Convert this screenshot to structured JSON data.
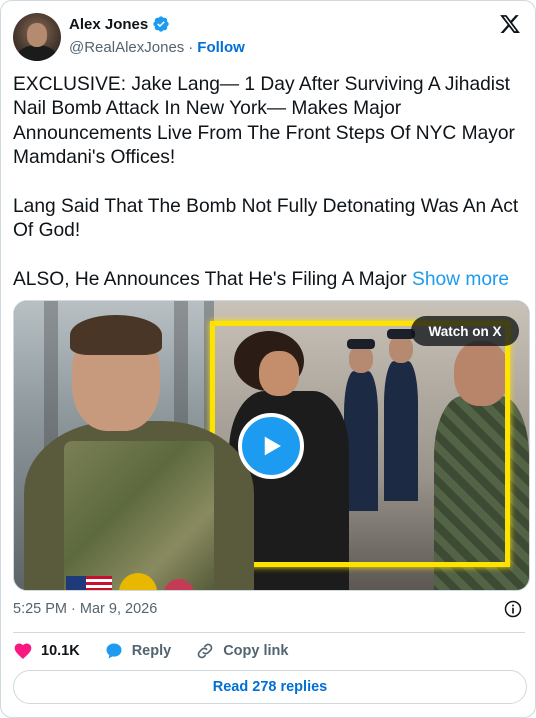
{
  "author": {
    "name": "Alex Jones",
    "handle": "@RealAlexJones",
    "separator": "·",
    "follow_label": "Follow",
    "verified": true
  },
  "tweet": {
    "paragraphs": [
      "EXCLUSIVE: Jake Lang— 1 Day After Surviving A Jihadist Nail Bomb Attack In New York— Makes Major Announcements Live From The Front Steps Of NYC Mayor Mamdani's Offices!",
      "Lang Said That The Bomb Not Fully Detonating Was An Act Of God!",
      "ALSO, He Announces That He's Filing A Major"
    ],
    "show_more_label": "Show more"
  },
  "media": {
    "watch_label": "Watch on X",
    "play_icon": "play-icon"
  },
  "meta": {
    "timestamp": "5:25 PM · Mar 9, 2026"
  },
  "actions": {
    "likes": "10.1K",
    "reply_label": "Reply",
    "copy_link_label": "Copy link"
  },
  "footer": {
    "read_replies_label": "Read 278 replies"
  },
  "colors": {
    "accent": "#1d9bf0",
    "link": "#006fd6",
    "heart": "#f91880",
    "muted": "#536471",
    "highlight_frame": "#ffe300"
  }
}
